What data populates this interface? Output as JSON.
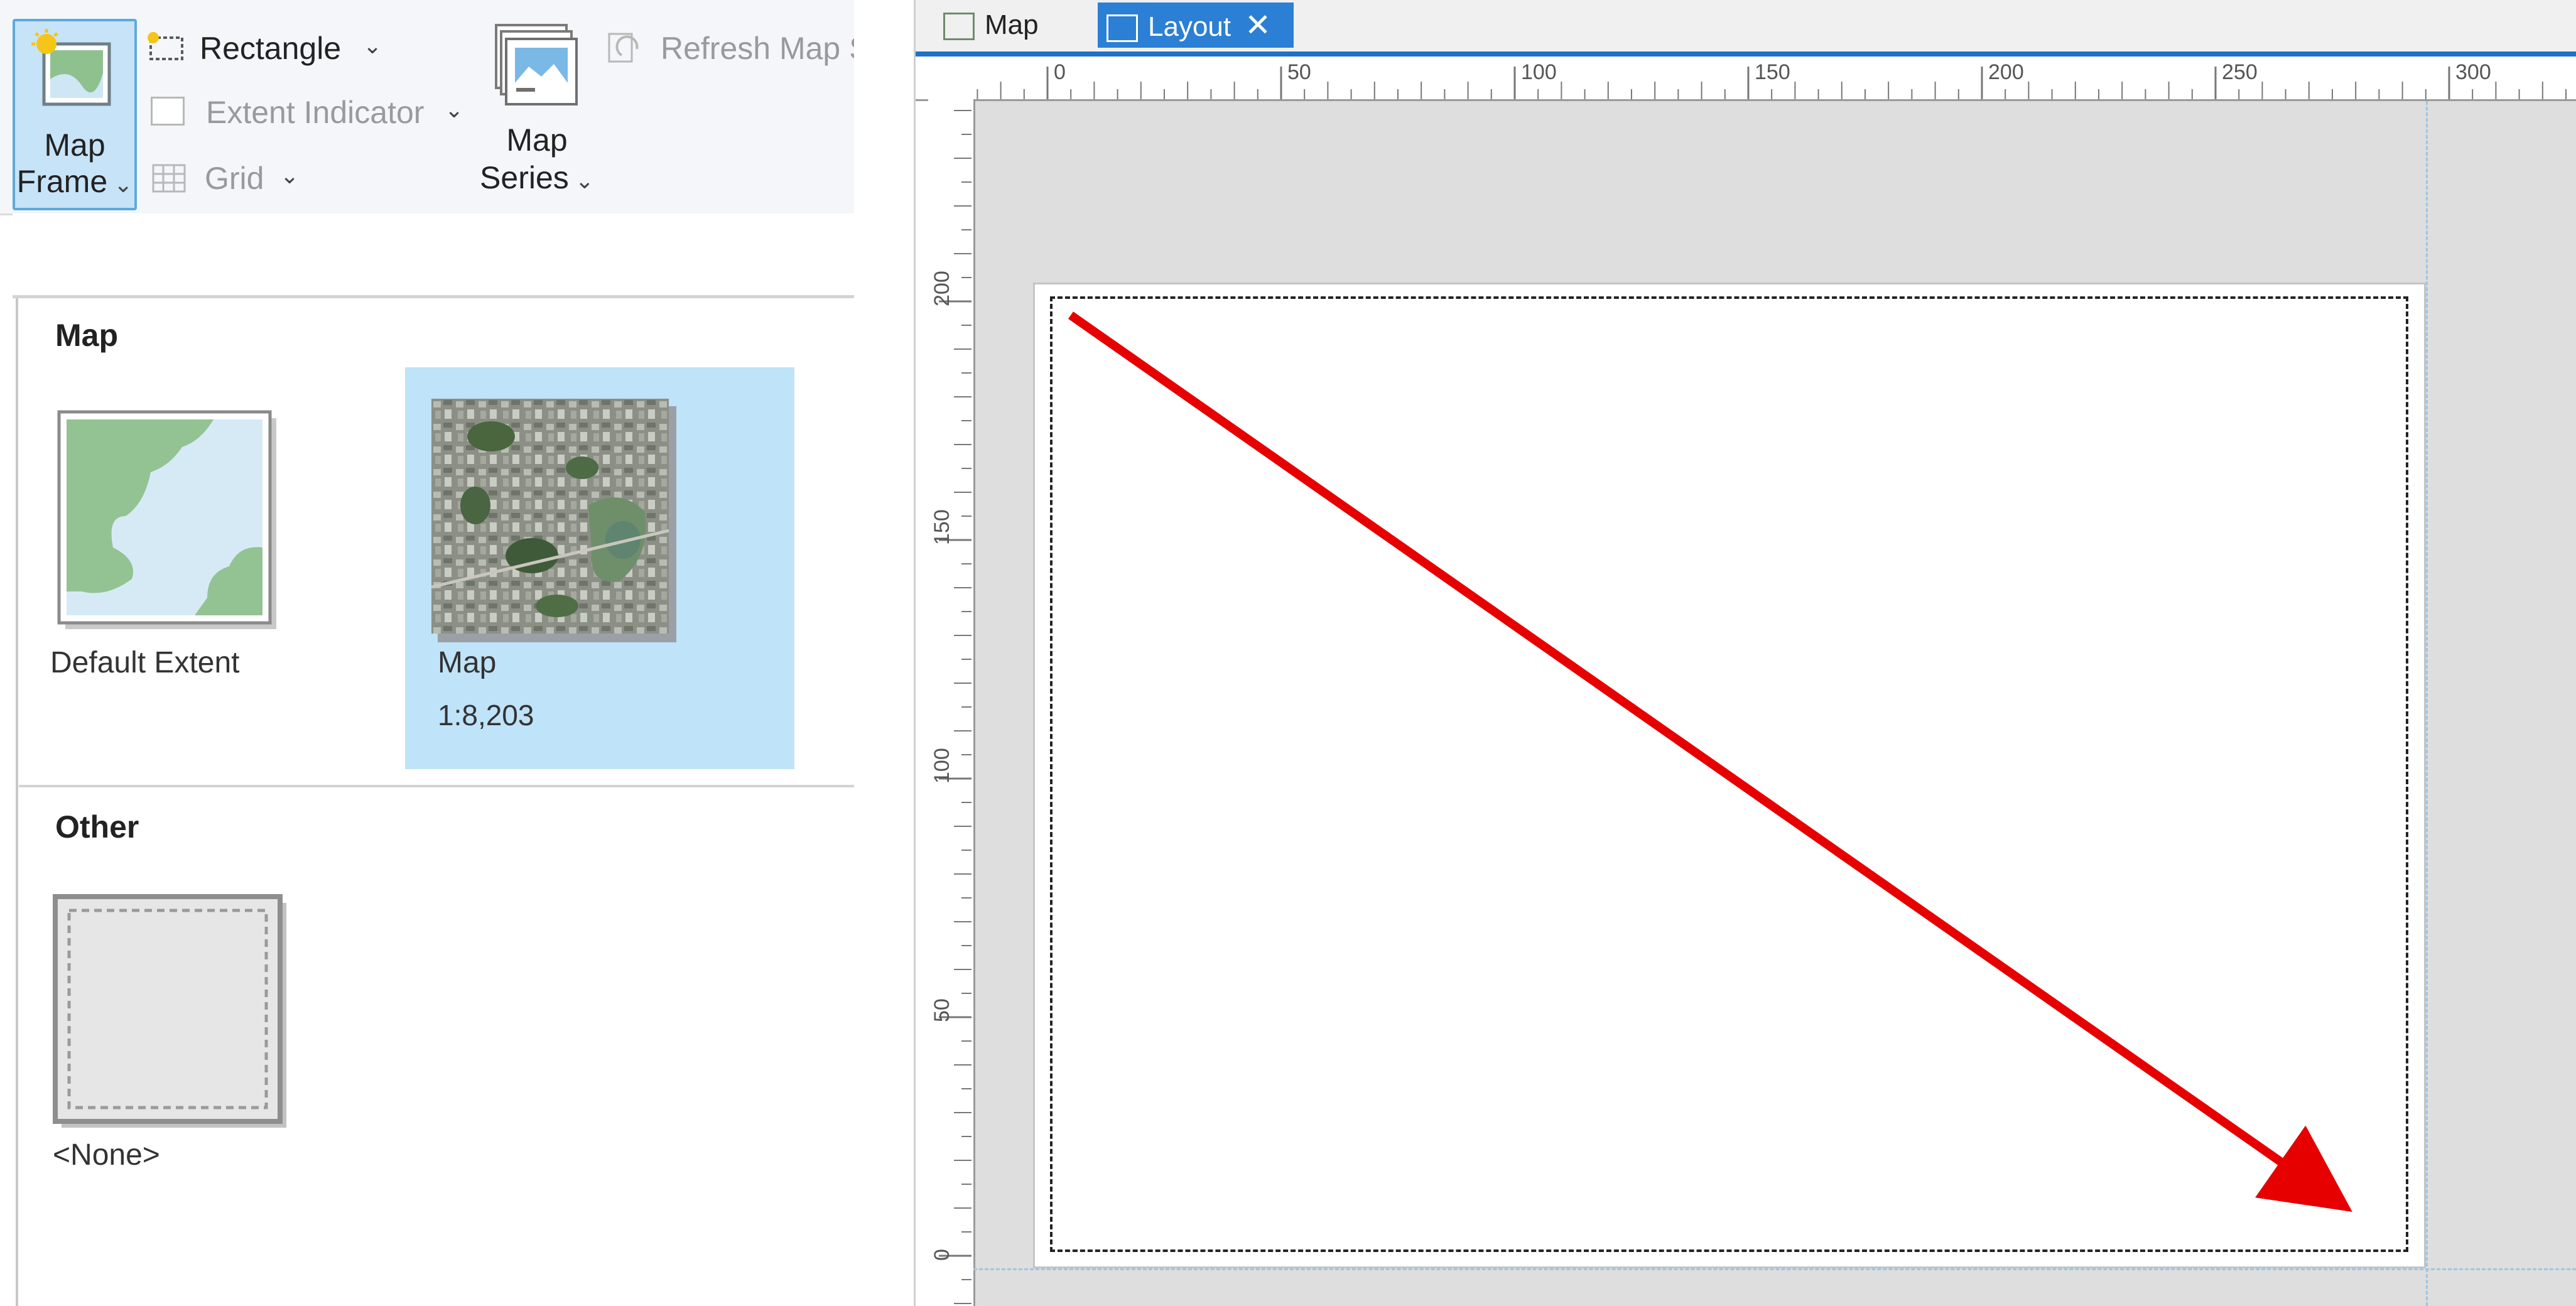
{
  "ribbon": {
    "map_frame_label_1": "Map",
    "map_frame_label_2": "Frame",
    "rectangle_label": "Rectangle",
    "extent_indicator_label": "Extent Indicator",
    "grid_label": "Grid",
    "map_series_label_1": "Map",
    "map_series_label_2": "Series",
    "refresh_label": "Refresh Map S"
  },
  "gallery": {
    "section_map": "Map",
    "items_map": [
      {
        "label": "Default Extent",
        "sublabel": ""
      },
      {
        "label": "Map",
        "sublabel": "1:8,203"
      }
    ],
    "section_other": "Other",
    "items_other": [
      {
        "label": "<None>"
      }
    ]
  },
  "tabs": [
    {
      "label": "Map"
    },
    {
      "label": "Layout"
    }
  ],
  "ruler_top_labels": [
    "0",
    "50",
    "100",
    "150",
    "200",
    "250",
    "300"
  ],
  "ruler_left_labels": [
    "200",
    "150",
    "100",
    "50",
    "0"
  ],
  "colors": {
    "accent": "#1e72c8",
    "selection": "#bfe3f8",
    "annotation_arrow": "#e60000"
  }
}
